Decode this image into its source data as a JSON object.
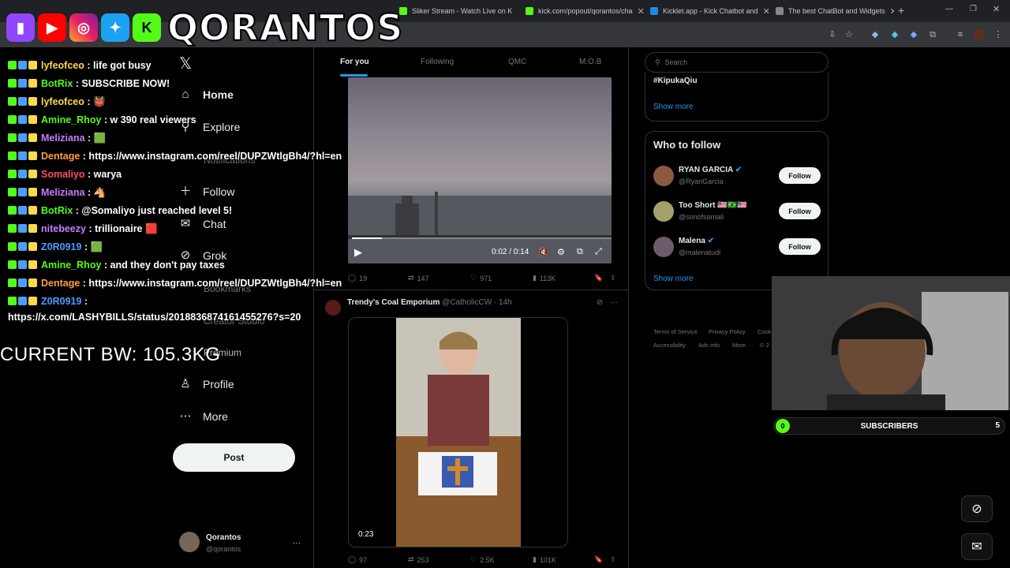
{
  "browser": {
    "tabs": [
      {
        "label": "Sliker Stream - Watch Live on K",
        "color": "#53fc18"
      },
      {
        "label": "kick.com/popout/qorantos/cha",
        "color": "#53fc18"
      },
      {
        "label": "Kicklet.app - Kick Chatbot and",
        "color": "#1e88e5"
      },
      {
        "label": "The best ChatBot and Widgets",
        "color": "#888888"
      }
    ],
    "new_tab": "+"
  },
  "overlay": {
    "brand": "QORANTOS",
    "current_bw": "CURRENT BW: 105.3KG"
  },
  "chat": [
    {
      "user": "lyfeofceo",
      "color": "#ffd84d",
      "msg": " : life got busy"
    },
    {
      "user": "BotRix",
      "color": "#53fc18",
      "msg": " : SUBSCRIBE NOW!"
    },
    {
      "user": "lyfeofceo",
      "color": "#ffd84d",
      "msg": " : 👹"
    },
    {
      "user": "Amine_Rhoy",
      "color": "#53fc18",
      "msg": " : w 390 real viewers"
    },
    {
      "user": "Meliziana",
      "color": "#c77dff",
      "msg": " :  🟩"
    },
    {
      "user": "Dentage",
      "color": "#ff9f43",
      "msg": " : https://www.instagram.com/reel/DUPZWtlgBh4/?hl=en"
    },
    {
      "user": "Somaliyo",
      "color": "#ff4d6d",
      "msg": " : warya"
    },
    {
      "user": "Meliziana",
      "color": "#c77dff",
      "msg": " :  🐴"
    },
    {
      "user": "BotRix",
      "color": "#53fc18",
      "msg": " : @Somaliyo just reached level 5!"
    },
    {
      "user": "nitebeezy",
      "color": "#c77dff",
      "msg": " : trillionaire  🟥"
    },
    {
      "user": "Z0R0919",
      "color": "#4d9dff",
      "msg": " :  🟩"
    },
    {
      "user": "Amine_Rhoy",
      "color": "#53fc18",
      "msg": " : and they don't pay taxes"
    },
    {
      "user": "Dentage",
      "color": "#ff9f43",
      "msg": " : https://www.instagram.com/reel/DUPZWtlgBh4/?hl=en"
    },
    {
      "user": "Z0R0919",
      "color": "#4d9dff",
      "msg": " :"
    }
  ],
  "chat_wrap": "https://x.com/LASHYBILLS/status/2018836874161455276?s=20",
  "x_sidebar": {
    "logo": "𝕏",
    "items": [
      {
        "label": "Home",
        "icon": "home-icon",
        "glyph": "⌂"
      },
      {
        "label": "Explore",
        "icon": "search-icon",
        "glyph": "⚲"
      },
      {
        "label": "Notifications",
        "icon": "bell-icon",
        "glyph": "🔔"
      },
      {
        "label": "Follow",
        "icon": "person-add-icon",
        "glyph": "👤"
      },
      {
        "label": "Chat",
        "icon": "mail-icon",
        "glyph": "✉"
      },
      {
        "label": "Grok",
        "icon": "grok-icon",
        "glyph": "⊘"
      },
      {
        "label": "Bookmarks",
        "icon": "bookmark-icon",
        "glyph": "🔖"
      },
      {
        "label": "Creator Studio",
        "icon": "studio-icon",
        "glyph": "▦"
      },
      {
        "label": "Premium",
        "icon": "premium-icon",
        "glyph": "𝕏"
      },
      {
        "label": "Profile",
        "icon": "profile-icon",
        "glyph": "👤"
      },
      {
        "label": "More",
        "icon": "more-icon",
        "glyph": "⋯"
      }
    ],
    "post": "Post",
    "account": {
      "name": "Qorantos",
      "handle": "@qorantos",
      "menu": "···"
    }
  },
  "feed": {
    "tabs": [
      "For you",
      "Following",
      "QMC",
      "M.O.B"
    ],
    "tweet1": {
      "time": "0:02 / 0:14",
      "replies": "19",
      "reposts": "147",
      "likes": "971",
      "views": "113K"
    },
    "tweet2": {
      "author": "Trendy's Coal Emporium",
      "handle": "@CatholicCW",
      "age": "· 14h",
      "duration": "0:23",
      "replies": "97",
      "reposts": "253",
      "likes": "2.5K",
      "views": "101K"
    }
  },
  "right": {
    "search_placeholder": "Search",
    "trend": "#KipukaQiu",
    "show_more": "Show more",
    "who_to_follow": "Who to follow",
    "follow_label": "Follow",
    "suggestions": [
      {
        "name": "RYAN GARCIA",
        "handle": "@RyanGarcia",
        "avatar": "#8a5a3c"
      },
      {
        "name": "Too Short 🇺🇸🇧🇷🇺🇸",
        "handle": "@sonofsomali",
        "avatar": "#a5a06a"
      },
      {
        "name": "Malena",
        "handle": "@malenatudi",
        "avatar": "#6d5a6a"
      }
    ],
    "show_more_2": "Show more",
    "footer": [
      "Terms of Service",
      "Privacy Policy",
      "Cook",
      "Accessibility",
      "Ads info",
      "More ···",
      "© 2"
    ]
  },
  "subs_bar": {
    "label": "SUBSCRIBERS",
    "start": "0",
    "end": "5"
  }
}
